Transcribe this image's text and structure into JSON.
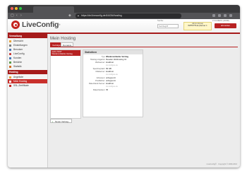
{
  "browser": {
    "url": "https://dnl.liveconfig.de:8443/#/hosting",
    "lock_icon": "lock-icon"
  },
  "header": {
    "logo_text": "LiveConfig",
    "search_label": "Suche:",
    "search_placeholder": "Suchbegriff",
    "build_info": "LiveConfig Build",
    "build_number": "2.3.0-BETA (r4000)",
    "server_info": "Server: dnl.liveconfig.de",
    "admin_line1": "Admin bitmap",
    "admin_line2": "ISPTUTTI.de (Server 1",
    "logout_label": "abmelden",
    "accent": "#a61b1b"
  },
  "sidebar": {
    "sections": [
      {
        "title": "Verwaltung",
        "items": [
          {
            "label": "Übersicht",
            "icon": "home-icon",
            "color": "#e8a33b"
          },
          {
            "label": "Einstellungen",
            "icon": "settings-icon",
            "color": "#7a7a7a"
          },
          {
            "label": "Benutzer",
            "icon": "user-icon",
            "color": "#4a78b5"
          },
          {
            "label": "LiveConfig",
            "icon": "liveconfig-icon",
            "color": "#c4241f"
          },
          {
            "label": "Kunden",
            "icon": "customers-icon",
            "color": "#4a78b5"
          },
          {
            "label": "Berichte",
            "icon": "reports-icon",
            "color": "#5a9a48"
          },
          {
            "label": "Statistik",
            "icon": "statistics-icon",
            "color": "#d2691e"
          }
        ]
      },
      {
        "title": "Hosting",
        "items": [
          {
            "label": "Angebote",
            "icon": "offers-icon",
            "color": "#e8a33b"
          },
          {
            "label": "Mein Hosting",
            "icon": "hosting-icon",
            "color": "#ffffff",
            "active": true
          },
          {
            "label": "SSL-Zertifikate",
            "icon": "ssl-icon",
            "color": "#c4241f"
          }
        ]
      }
    ]
  },
  "main": {
    "title": "Mein Hosting",
    "tabs": [
      {
        "label": "Verträge",
        "active": true
      },
      {
        "label": "Domains",
        "active": false
      }
    ],
    "contract_title": "web1-TEST",
    "contract_subtitle": "Wiederverkäufer-Vertrag",
    "new_contract_label": "Neuer Vertrag...",
    "stats": {
      "heading": "Statistiken",
      "rows": [
        {
          "key": "Typ:",
          "value": "Wiederverkäufer-Vertrag",
          "strong": true
        },
        {
          "key": "Hosting-Angebot:",
          "value": "Reseller Webhosting 01"
        },
        {
          "key": "Webserver:",
          "value": "localhost",
          "sub": "srv.configure.de"
        },
        {
          "key": "Speicherplatz:",
          "value": "99 GB"
        },
        {
          "key": "Mailserver:",
          "value": "localhost",
          "sub": "srv.configure.de"
        },
        {
          "key": "Adressen:",
          "value": "unbegrenzt"
        },
        {
          "key": "Postfächer:",
          "value": "unbegrenzt"
        },
        {
          "key": "Datenbank-Server:",
          "value": "localhost",
          "sub": "srv.configure.de"
        },
        {
          "key": "Datenbanken:",
          "value": "35"
        }
      ]
    }
  },
  "footer": {
    "text": "LiveConfig® · Copyright © 2009-2016"
  }
}
